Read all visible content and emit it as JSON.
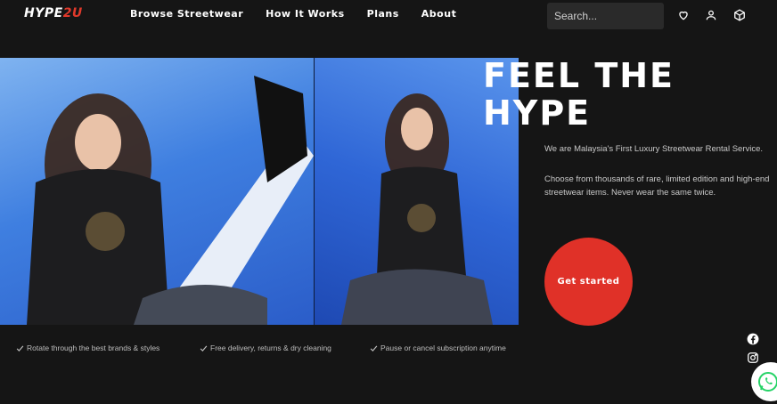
{
  "brand": {
    "logo_main": "HYPE",
    "logo_accent": "2U",
    "accent_color": "#e0392b"
  },
  "nav": {
    "items": [
      "Browse Streetwear",
      "How It Works",
      "Plans",
      "About"
    ]
  },
  "search": {
    "placeholder": "Search..."
  },
  "header_icons": [
    "heart-icon",
    "user-icon",
    "box-icon"
  ],
  "hero": {
    "title_line1": "FEEL THE",
    "title_line2": "HYPE",
    "tagline": "We are Malaysia's First Luxury Streetwear Rental Service.",
    "description_line1": "Choose from thousands of rare, limited edition and high-end",
    "description_line2": "streetwear items. Never wear the same twice.",
    "cta_label": "Get started",
    "cta_color": "#e03128"
  },
  "features": [
    "Rotate through the best brands & styles",
    "Free delivery, returns & dry cleaning",
    "Pause or cancel subscription anytime"
  ],
  "social": [
    "facebook-icon",
    "instagram-icon",
    "whatsapp-icon"
  ]
}
